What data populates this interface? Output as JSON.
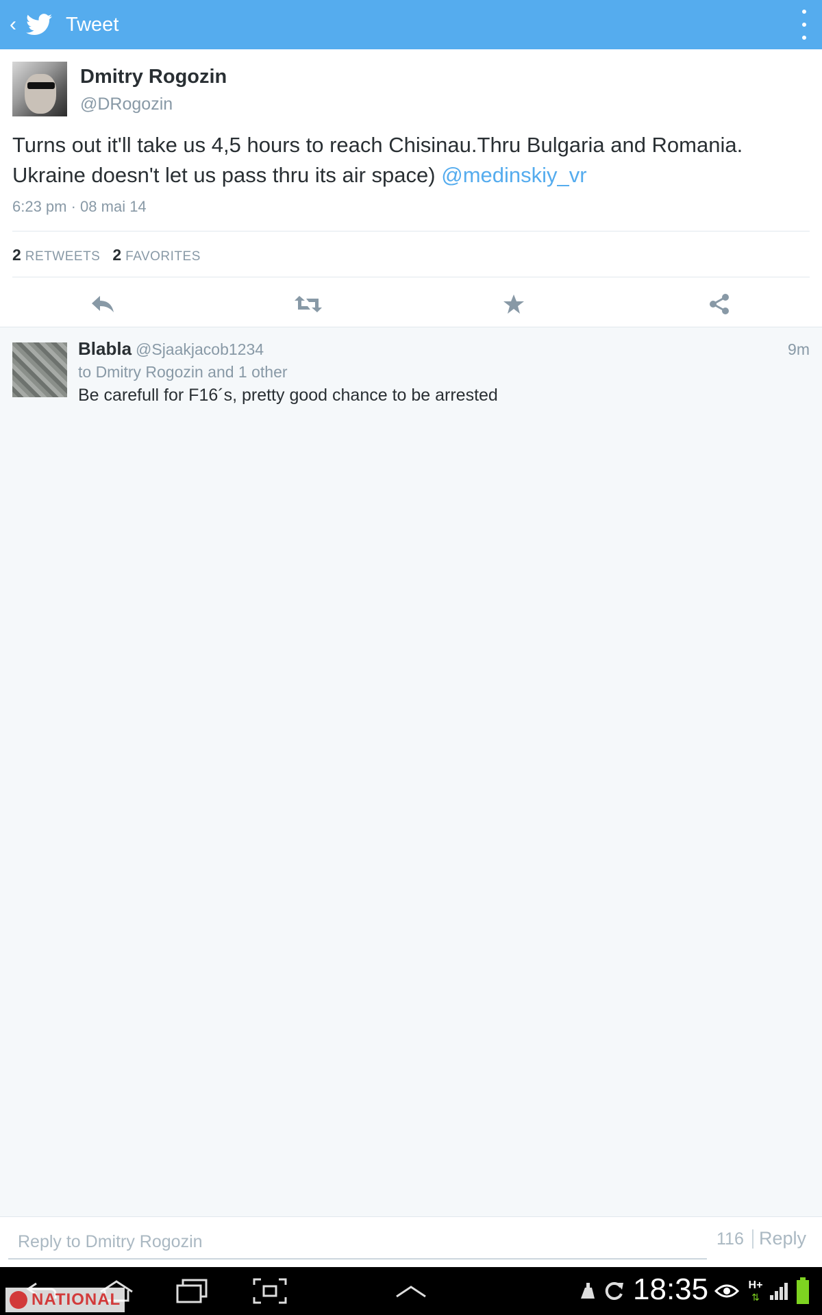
{
  "topbar": {
    "back_glyph": "‹",
    "title": "Tweet"
  },
  "tweet": {
    "author_name": "Dmitry Rogozin",
    "author_handle": "@DRogozin",
    "text_main": "Turns out it'll take us 4,5 hours to reach Chisinau.Thru Bulgaria and Romania. Ukraine doesn't let us pass thru its air space) ",
    "mention": "@medinskiy_vr",
    "timestamp": "6:23 pm · 08 mai 14",
    "retweets_count": "2",
    "retweets_label": "RETWEETS",
    "favorites_count": "2",
    "favorites_label": "FAVORITES",
    "actions": [
      "reply-icon",
      "retweet-icon",
      "favorite-star-icon",
      "share-icon"
    ]
  },
  "reply_item": {
    "name": "Blabla",
    "handle": "@Sjaakjacob1234",
    "time": "9m",
    "to_line": "to Dmitry Rogozin and 1 other",
    "text": "Be carefull for F16´s, pretty good chance to be arrested"
  },
  "composer": {
    "placeholder": "Reply to Dmitry Rogozin",
    "char_count": "116",
    "reply_label": "Reply"
  },
  "system_bar": {
    "clock": "18:35",
    "network": "H+",
    "watermark": "NATIONAL"
  },
  "colors": {
    "brand": "#55acee",
    "text": "#292f33",
    "muted": "#8899a6",
    "background": "#f5f8fa"
  }
}
